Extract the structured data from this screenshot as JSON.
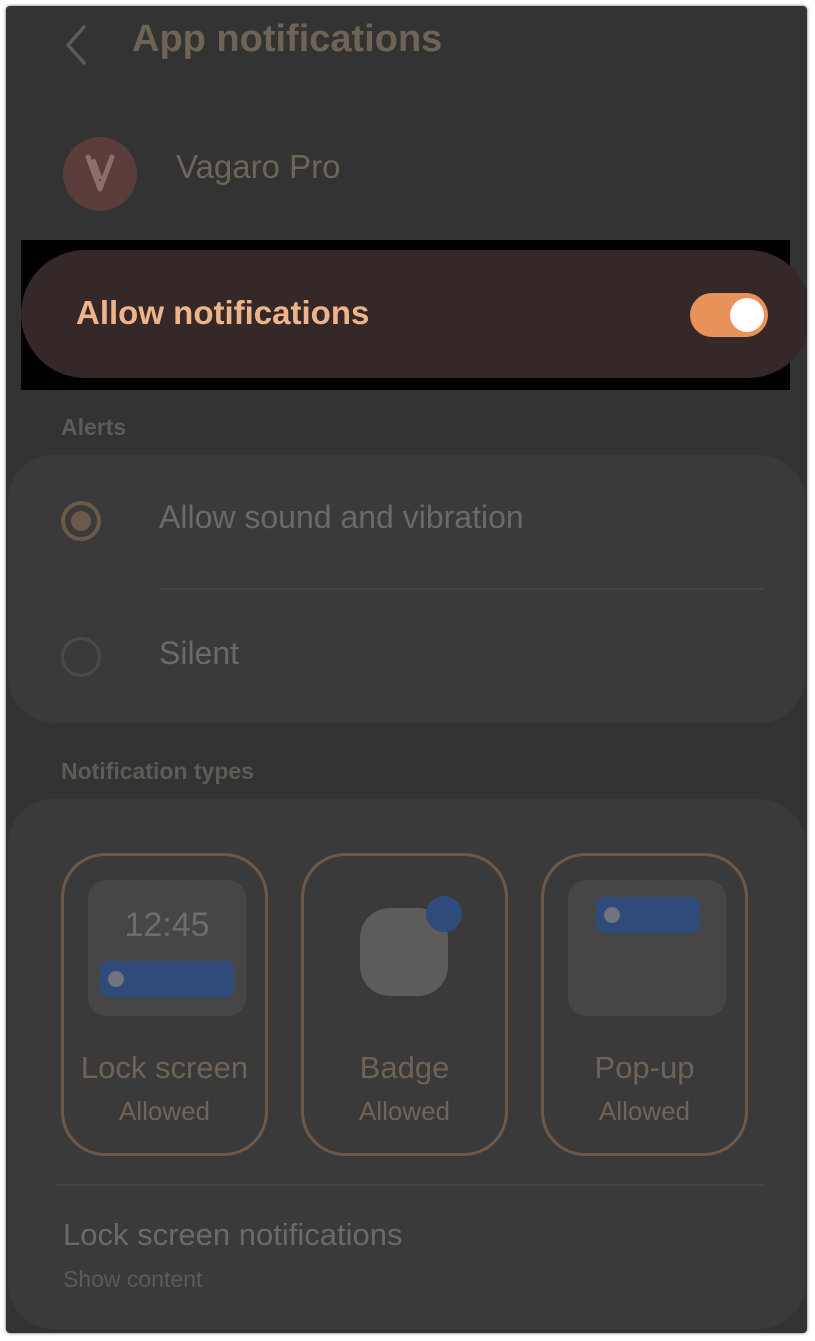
{
  "header": {
    "title": "App notifications",
    "back_icon": "chevron-left-icon"
  },
  "app": {
    "name": "Vagaro Pro",
    "icon": "vagaro-logo-icon"
  },
  "allow_notifications": {
    "label": "Allow notifications",
    "enabled": true,
    "accent_color": "#e8925a"
  },
  "alerts": {
    "section_label": "Alerts",
    "options": [
      {
        "label": "Allow sound and vibration",
        "selected": true
      },
      {
        "label": "Silent",
        "selected": false
      }
    ]
  },
  "notification_types": {
    "section_label": "Notification types",
    "tiles": [
      {
        "name": "Lock screen",
        "status": "Allowed",
        "preview_time": "12:45"
      },
      {
        "name": "Badge",
        "status": "Allowed"
      },
      {
        "name": "Pop-up",
        "status": "Allowed"
      }
    ],
    "lock_screen": {
      "title": "Lock screen notifications",
      "value": "Show content"
    }
  }
}
